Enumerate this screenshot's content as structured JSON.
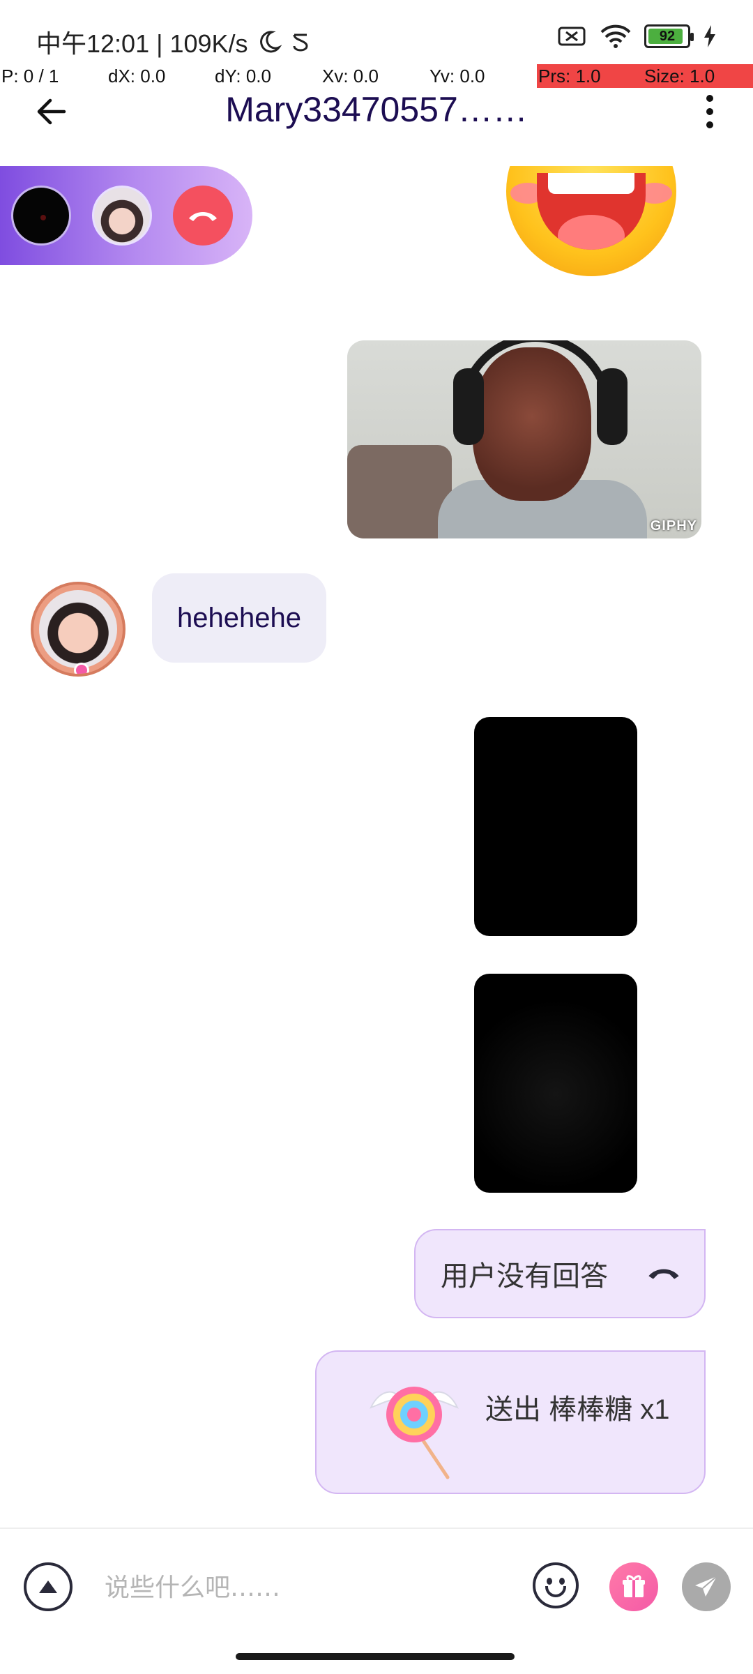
{
  "status_bar": {
    "time_text": "中午12:01 | 109K/s",
    "battery_level": "92",
    "battery_percent": 92
  },
  "debug_overlay": {
    "p": "P: 0 / 1",
    "dx": "dX: 0.0",
    "dy": "dY: 0.0",
    "xv": "Xv: 0.0",
    "yv": "Yv: 0.0",
    "prs": "Prs: 1.0",
    "size": "Size: 1.0"
  },
  "header": {
    "title": "Mary33470557……"
  },
  "messages": {
    "incoming_text": "hehehehe",
    "call_status": "用户没有回答",
    "gift_text": "送出 棒棒糖 x1",
    "giphy_badge": "GIPHY"
  },
  "input": {
    "placeholder": "说些什么吧……"
  },
  "colors": {
    "accent_purple": "#7f4de0",
    "bubble_out": "#f0e6fc",
    "bubble_in": "#eeedf7",
    "hangup_red": "#f4505f",
    "gift_pink": "#f45aa7",
    "debug_red": "#f04545"
  },
  "icons": {
    "back": "arrow-left-icon",
    "more": "more-vertical-icon",
    "hangup": "phone-hangup-icon",
    "expand": "chevron-up-circle-icon",
    "emoji": "smiley-icon",
    "gift": "gift-icon",
    "send": "send-plane-icon"
  }
}
